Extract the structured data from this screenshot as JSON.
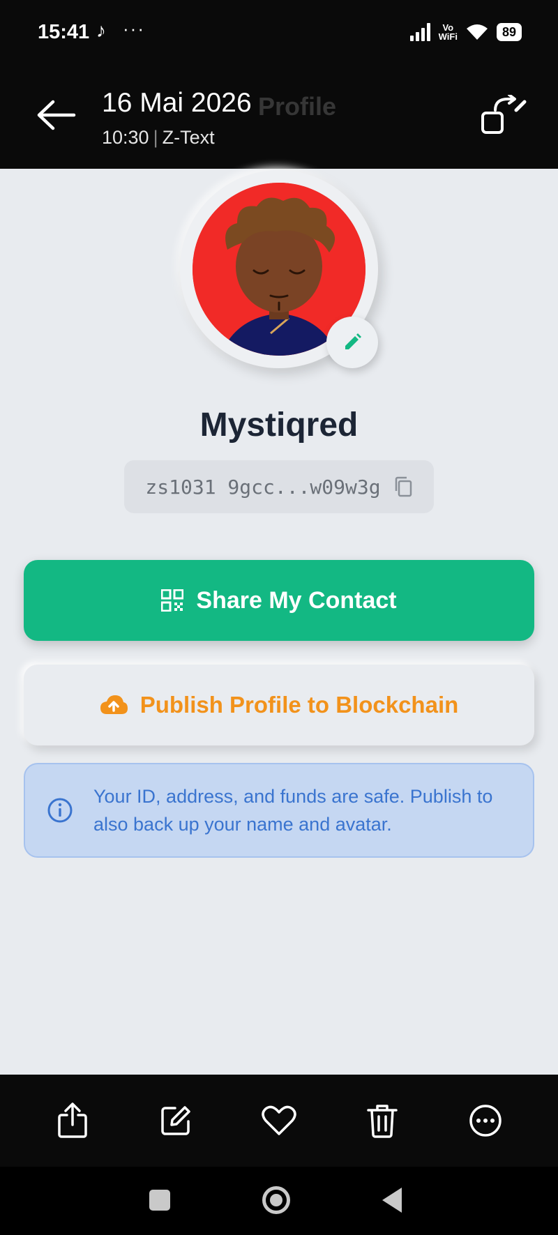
{
  "status_bar": {
    "time": "15:41",
    "note_icon": "music-note-icon",
    "more": "···",
    "network_label_top": "Vo",
    "network_label_bottom": "WiFi",
    "battery": "89"
  },
  "header": {
    "title": "16 Mai 2026",
    "ghost_title": "Profile",
    "subtitle_time": "10:30",
    "subtitle_separator": "|",
    "subtitle_app": "Z-Text"
  },
  "profile": {
    "name": "Mystiqred",
    "address": "zs1031 9gcc...w09w3g",
    "avatar_bg": "#f12a27"
  },
  "actions": {
    "share_label": "Share My Contact",
    "publish_label": "Publish Profile to Blockchain"
  },
  "info": {
    "text": "Your ID, address, and funds are safe. Publish to also back up your name and avatar."
  },
  "bottom_bar": {
    "items": [
      "share-icon",
      "edit-icon",
      "heart-icon",
      "trash-icon",
      "more-icon"
    ]
  },
  "colors": {
    "accent_green": "#13b883",
    "accent_orange": "#f2921b",
    "info_blue": "#3a74cf"
  }
}
